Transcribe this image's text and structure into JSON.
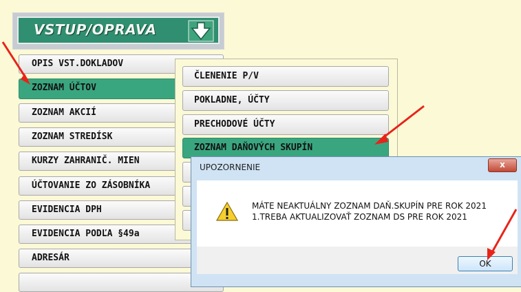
{
  "header": {
    "title": "VSTUP/OPRAVA"
  },
  "menu": {
    "items": [
      {
        "label": "OPIS VST.DOKLADOV"
      },
      {
        "label": "ZOZNAM ÚČTOV",
        "selected": true
      },
      {
        "label": "ZOZNAM AKCIÍ"
      },
      {
        "label": "ZOZNAM STREDÍSK"
      },
      {
        "label": "KURZY ZAHRANIČ. MIEN"
      },
      {
        "label": "ÚČTOVANIE ZO ZÁSOBNÍKA"
      },
      {
        "label": "EVIDENCIA DPH"
      },
      {
        "label": "EVIDENCIA PODĽA §49a"
      },
      {
        "label": "ADRESÁR"
      }
    ]
  },
  "submenu": {
    "items": [
      {
        "label": "ČLENENIE P/V"
      },
      {
        "label": "POKLADNE, ÚČTY"
      },
      {
        "label": "PRECHODOVÉ ÚČTY"
      },
      {
        "label": "ZOZNAM DAŇOVÝCH SKUPÍN",
        "selected": true
      }
    ]
  },
  "dialog": {
    "title": "UPOZORNENIE",
    "close_label": "x",
    "message_line1": "MÁTE NEAKTUÁLNY ZOZNAM DAŇ.SKUPÍN PRE ROK 2021",
    "message_line2": "1.TREBA AKTUALIZOVAŤ ZOZNAM DS PRE ROK 2021",
    "ok_label": "OK",
    "icon": "warning-icon"
  },
  "colors": {
    "selected": "#3aa680",
    "background": "#fbf9d6",
    "annotation_arrow": "#e8231a"
  }
}
